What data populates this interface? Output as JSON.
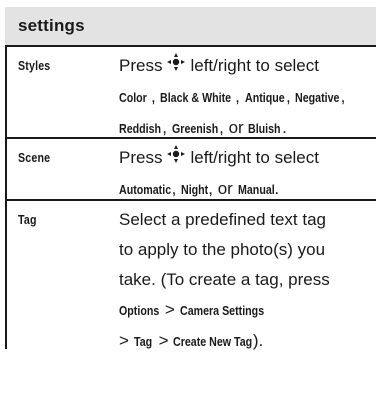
{
  "header": {
    "title": "settings"
  },
  "rows": [
    {
      "label": "Styles",
      "press": "Press",
      "action": "left/right to select",
      "options": [
        "Color",
        "Black & White",
        "Antique",
        "Negative",
        "Reddish",
        "Greenish",
        "Bluish"
      ],
      "or": "or"
    },
    {
      "label": "Scene",
      "press": "Press",
      "action": "left/right to select",
      "options": [
        "Automatic",
        "Night",
        "Manual"
      ],
      "or": "or"
    },
    {
      "label": "Tag",
      "lines": [
        "Select a predefined text tag",
        "to apply to the photo(s) you",
        "take. (To create a tag, press"
      ],
      "path": [
        "Options",
        "Camera Settings",
        "Tag",
        "Create New Tag"
      ],
      "separator": ">",
      "tail": ")."
    }
  ],
  "icons": {
    "nav_key": "nav-key-icon"
  }
}
